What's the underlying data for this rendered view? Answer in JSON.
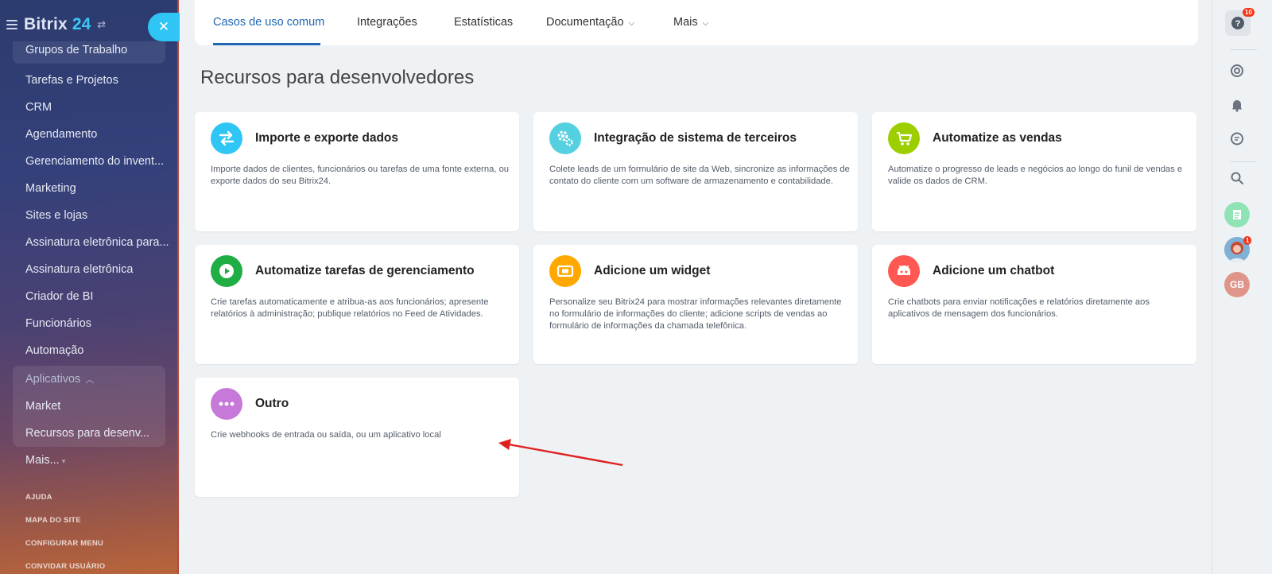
{
  "sidebar": {
    "logo_text": "Bitrix",
    "logo_num": "24",
    "items": [
      {
        "label": "Grupos de Trabalho"
      },
      {
        "label": "Tarefas e Projetos"
      },
      {
        "label": "CRM"
      },
      {
        "label": "Agendamento"
      },
      {
        "label": "Gerenciamento do invent..."
      },
      {
        "label": "Marketing"
      },
      {
        "label": "Sites e lojas"
      },
      {
        "label": "Assinatura eletrônica para..."
      },
      {
        "label": "Assinatura eletrônica"
      },
      {
        "label": "Criador de BI"
      },
      {
        "label": "Funcionários"
      },
      {
        "label": "Automação"
      }
    ],
    "apps_group": {
      "label": "Aplicativos",
      "items": [
        {
          "label": "Market"
        },
        {
          "label": "Recursos para desenv..."
        }
      ]
    },
    "more_label": "Mais...",
    "footer": [
      "AJUDA",
      "MAPA DO SITE",
      "CONFIGURAR MENU",
      "CONVIDAR USUÁRIO"
    ]
  },
  "tabs": [
    {
      "label": "Casos de uso comum",
      "active": true
    },
    {
      "label": "Integrações"
    },
    {
      "label": "Estatísticas"
    },
    {
      "label": "Documentação"
    },
    {
      "label": "Mais"
    }
  ],
  "page_title": "Recursos para desenvolvedores",
  "cards": [
    {
      "title": "Importe e exporte dados",
      "desc": "Importe dados de clientes, funcionários ou tarefas de uma fonte externa, ou exporte dados do seu Bitrix24.",
      "icon": "swap-arrows-icon",
      "color": "#2fc6f6"
    },
    {
      "title": "Integração de sistema de terceiros",
      "desc": "Colete leads de um formulário de site da Web, sincronize as informações de contato do cliente com um software de armazenamento e contabilidade.",
      "icon": "gears-icon",
      "color": "#55d0e0"
    },
    {
      "title": "Automatize as vendas",
      "desc": "Automatize o progresso de leads e negócios ao longo do funil de vendas e valide os dados de CRM.",
      "icon": "cart-icon",
      "color": "#9dcf00"
    },
    {
      "title": "Automatize tarefas de gerenciamento",
      "desc": "Crie tarefas automaticamente e atribua-as aos funcionários; apresente relatórios à administração; publique relatórios no Feed de Atividades.",
      "icon": "play-icon",
      "color": "#1eae43"
    },
    {
      "title": "Adicione um widget",
      "desc": "Personalize seu Bitrix24 para mostrar informações relevantes diretamente no formulário de informações do cliente; adicione scripts de vendas ao formulário de informações da chamada telefônica.",
      "icon": "widget-icon",
      "color": "#ffa900"
    },
    {
      "title": "Adicione um chatbot",
      "desc": "Crie chatbots para enviar notificações e relatórios diretamente aos aplicativos de mensagem dos funcionários.",
      "icon": "robot-icon",
      "color": "#ff5752"
    },
    {
      "title": "Outro",
      "desc": "Crie webhooks de entrada ou saída, ou um aplicativo local",
      "icon": "dots-icon",
      "color": "#c679d9"
    }
  ],
  "right_panel": {
    "help_badge": "10",
    "avatar_badge": "1",
    "initials": "GB"
  },
  "colors": {
    "accent": "#2066b0",
    "close_button": "#2fc6f6",
    "arrow": "#e02020"
  }
}
